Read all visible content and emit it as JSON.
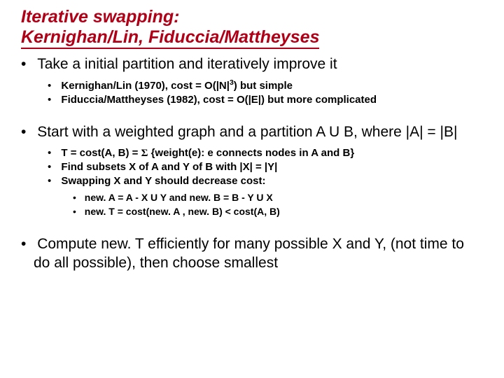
{
  "title_line1": "Iterative swapping:",
  "title_line2": "Kernighan/Lin, Fiduccia/Mattheyses",
  "b1": "Take a initial partition and iteratively improve it",
  "b1a_pre": "Kernighan/Lin (1970), cost = O(|N|",
  "b1a_sup": "3",
  "b1a_post": ") but simple",
  "b1b": "Fiduccia/Mattheyses (1982), cost = O(|E|) but more complicated",
  "b2": "Start with a weighted graph and a partition A U B, where |A| = |B|",
  "b2a_pre": "T = cost(A, B) = ",
  "b2a_sigma": "Σ",
  "b2a_post": " {weight(e): e connects nodes in A and B}",
  "b2b": "Find subsets X of A and Y of B with |X| = |Y|",
  "b2c": "Swapping X and Y should decrease cost:",
  "b2c1": "new. A = A - X U Y    and    new. B = B - Y U X",
  "b2c2": "new. T = cost(new. A , new. B) < cost(A, B)",
  "b3": "Compute new. T efficiently for many possible X and Y, (not time to do all possible), then choose smallest"
}
